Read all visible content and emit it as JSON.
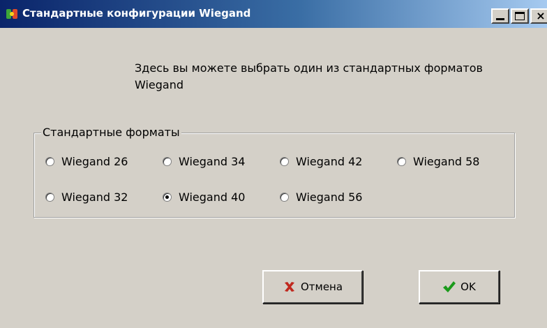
{
  "window": {
    "title": "Стандартные конфигурации Wiegand",
    "minimize_glyph": "_",
    "maximize_glyph": "□",
    "close_glyph": "×"
  },
  "description": "Здесь вы можете выбрать один из стандартных форматов Wiegand",
  "formats": {
    "group_title": "Стандартные форматы",
    "selected": "Wiegand 40",
    "options": [
      {
        "label": "Wiegand 26",
        "checked": false
      },
      {
        "label": "Wiegand 34",
        "checked": false
      },
      {
        "label": "Wiegand 42",
        "checked": false
      },
      {
        "label": "Wiegand 58",
        "checked": false
      },
      {
        "label": "Wiegand 32",
        "checked": false
      },
      {
        "label": "Wiegand 40",
        "checked": true
      },
      {
        "label": "Wiegand 56",
        "checked": false
      }
    ]
  },
  "buttons": {
    "cancel_label": "Отмена",
    "cancel_icon": "red-x-icon",
    "ok_label": "OK",
    "ok_icon": "green-checkmark-icon"
  },
  "colors": {
    "titlebar_start": "#0a246a",
    "titlebar_end": "#a6caf0",
    "dialog_background": "#d4d0c8",
    "cancel_icon_color": "#c0281e",
    "ok_icon_color": "#1a9a1a"
  }
}
